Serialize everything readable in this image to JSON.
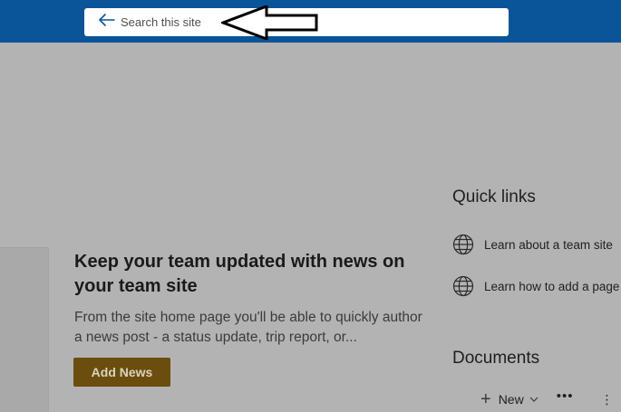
{
  "header": {
    "search": {
      "placeholder": "Search this site",
      "value": ""
    }
  },
  "news": {
    "heading": "Keep your team updated with news on your team site",
    "body": "From the site home page you'll be able to quickly author a news post - a status update, trip report, or...",
    "add_button_label": "Add News"
  },
  "quick_links": {
    "title": "Quick links",
    "items": [
      {
        "label": "Learn about a team site",
        "icon": "globe-icon"
      },
      {
        "label": "Learn how to add a page",
        "icon": "globe-icon"
      }
    ]
  },
  "documents": {
    "title": "Documents",
    "toolbar": {
      "new_label": "New"
    }
  },
  "colors": {
    "header_bg": "#0a5499",
    "overlay_bg": "#b3b3b3",
    "add_news_bg": "#6b4e0d",
    "back_arrow": "#0a5499"
  }
}
